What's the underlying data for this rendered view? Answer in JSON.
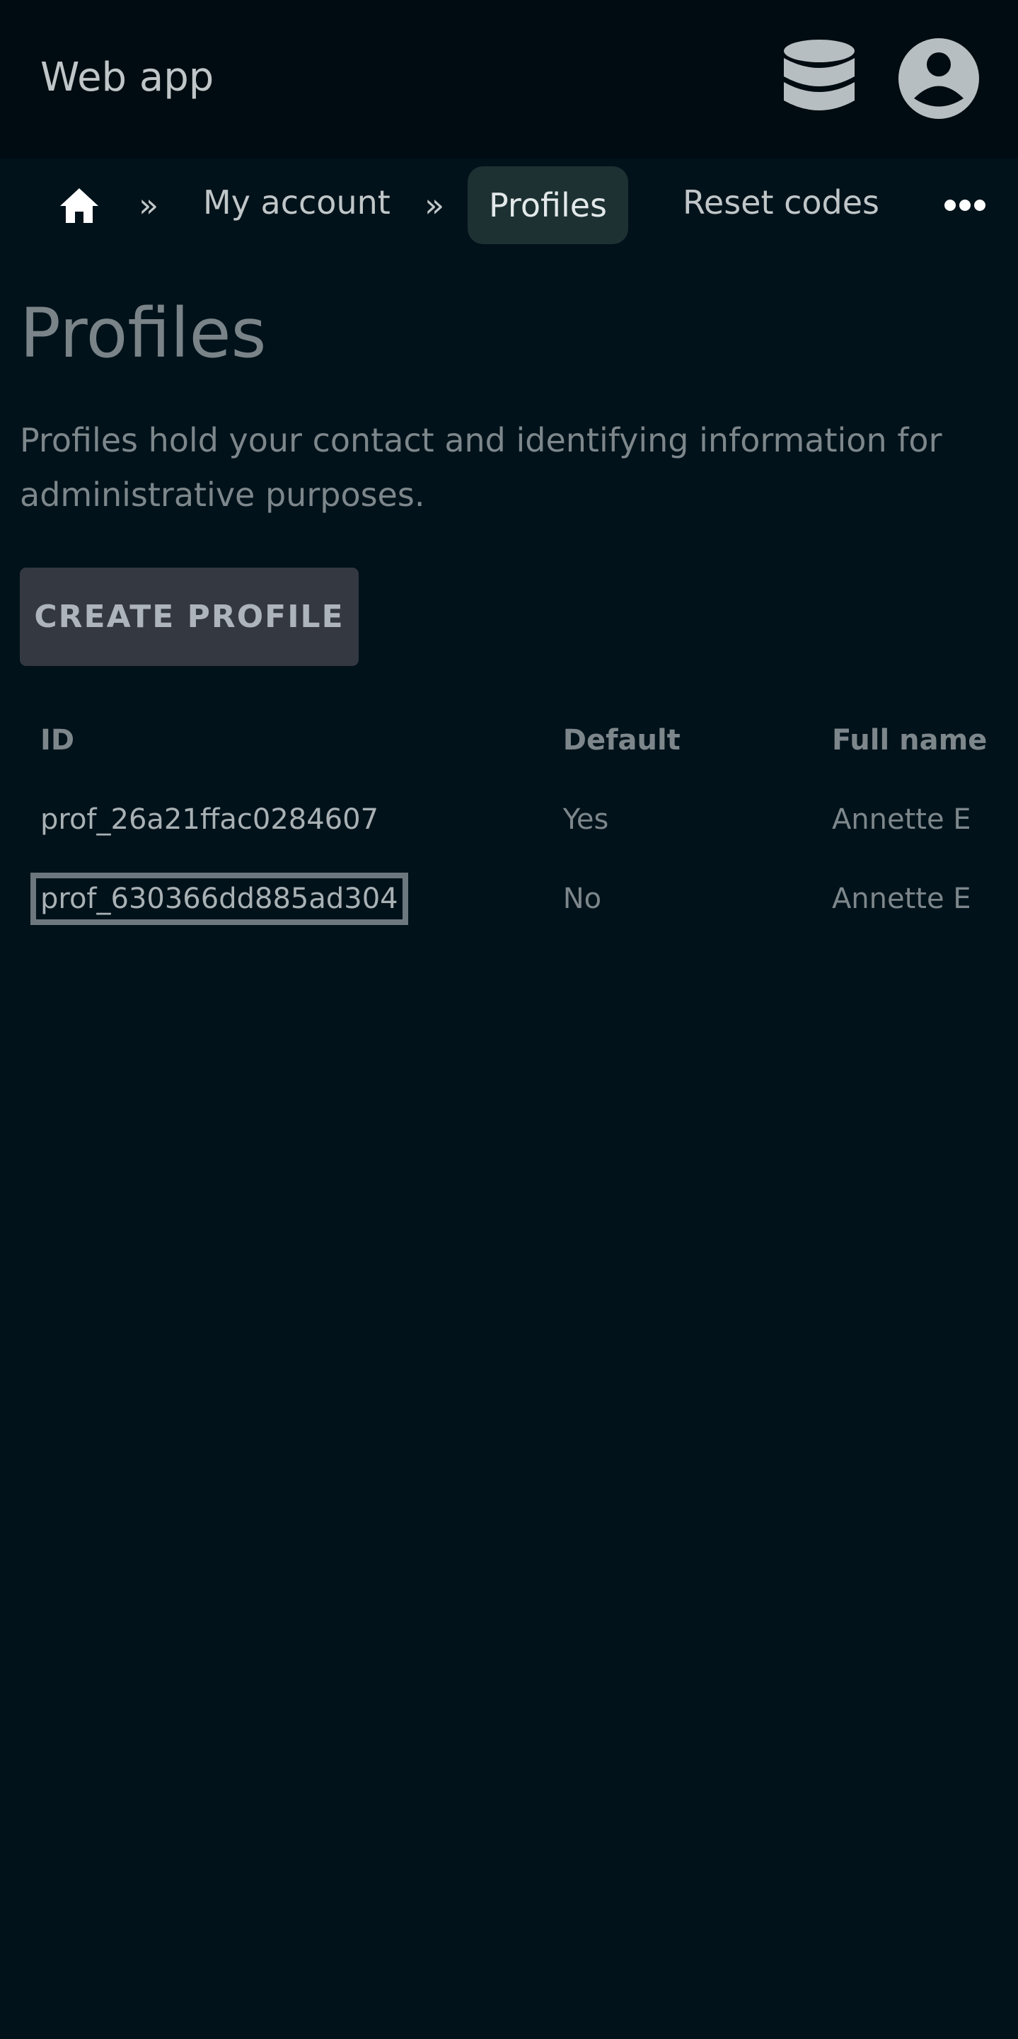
{
  "header": {
    "app_title": "Web app",
    "icons": [
      "database-icon",
      "account-icon"
    ]
  },
  "nav": {
    "separator": "»",
    "items": [
      {
        "label": "My account"
      },
      {
        "label": "Profiles",
        "active": true
      },
      {
        "label": "Reset codes"
      }
    ],
    "icons": [
      "home-icon",
      "more-icon"
    ]
  },
  "main": {
    "title": "Profiles",
    "description": "Profiles hold your contact and identifying information for administrative purposes.",
    "create_button_label": "CREATE PROFILE"
  },
  "table": {
    "columns": [
      "ID",
      "Default",
      "Full name"
    ],
    "rows": [
      {
        "id": "prof_26a21ffac0284607",
        "default": "Yes",
        "full_name": "Annette E"
      },
      {
        "id": "prof_630366dd885ad304",
        "default": "No",
        "full_name": "Annette E",
        "focused": true
      }
    ]
  },
  "colors": {
    "background": "#01121a",
    "header_background": "#000c11",
    "active_tab": "#1d3133",
    "button": "#343840"
  }
}
